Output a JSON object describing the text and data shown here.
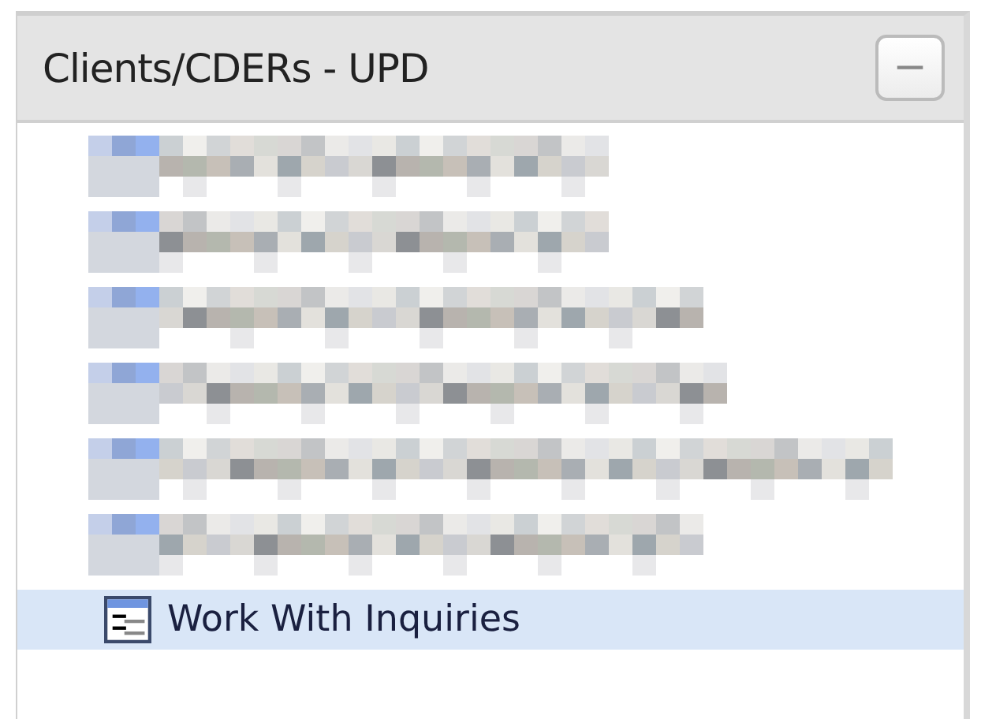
{
  "panel": {
    "title": "Clients/CDERs - UPD",
    "collapse_button": "−",
    "expanded": true
  },
  "items": [
    {
      "kind": "redacted",
      "selected": false
    },
    {
      "kind": "redacted",
      "selected": false
    },
    {
      "kind": "redacted",
      "selected": false
    },
    {
      "kind": "redacted",
      "selected": false
    },
    {
      "kind": "redacted",
      "selected": false
    },
    {
      "kind": "redacted",
      "selected": false
    },
    {
      "kind": "item",
      "label": "Work With Inquiries",
      "selected": true
    }
  ]
}
